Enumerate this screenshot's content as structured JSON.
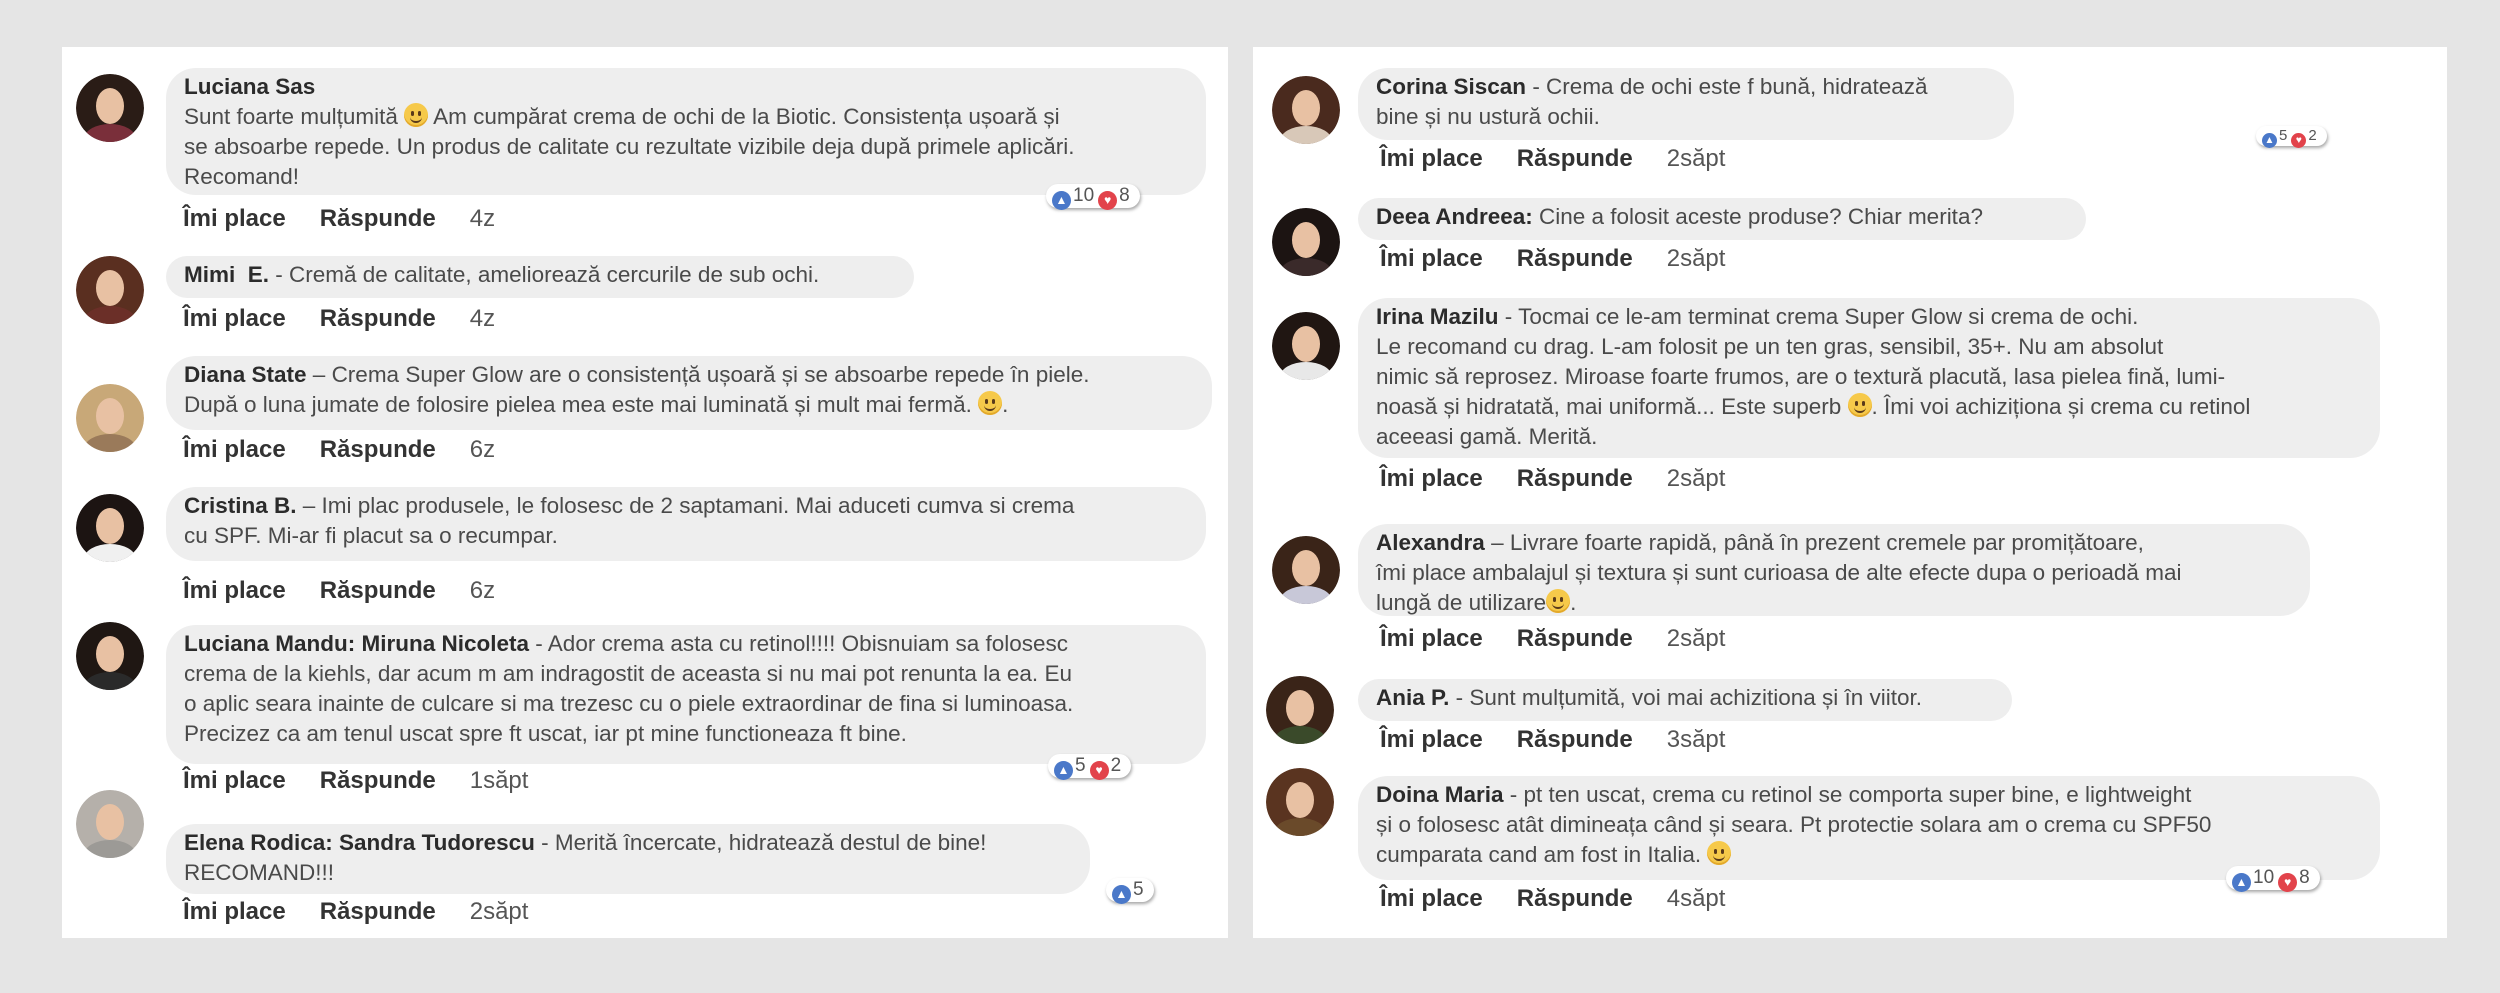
{
  "actions": {
    "like": "Îmi place",
    "reply": "Răspunde"
  },
  "colors": {
    "bubble": "#eeeeee",
    "like_icon": "#4a78c9",
    "love_icon": "#e2434b",
    "background": "#e5e5e5"
  },
  "icons": {
    "like": "thumbs-up-icon",
    "love": "heart-icon",
    "emoji": "smiley-emoji-icon"
  },
  "left": [
    {
      "name": "Luciana Sas",
      "text_html_lines": "Sunt foarte mulțumită 🙂 Am cumpărat crema de ochi de la Biotic. Consistența ușoară și\nse absoarbe repede. Un produs de calitate cu rezultate vizibile deja după primele aplicări.\nRecomand!",
      "time": "4z",
      "likes": "10",
      "loves": "8"
    },
    {
      "name": "Mimi  E.",
      "text_html_lines": " - Cremă de calitate, ameliorează cercurile de sub ochi.",
      "time": "4z"
    },
    {
      "name": "Diana State",
      "text_html_lines": " – Crema Super Glow are o consistență ușoară și se absoarbe repede în piele.\nDupă o luna jumate de folosire pielea mea este mai luminată și mult mai fermă. 🙂.",
      "time": "6z"
    },
    {
      "name": "Cristina B.",
      "text_html_lines": " – Imi plac produsele, le folosesc de 2 saptamani. Mai aduceti cumva si crema\ncu SPF. Mi-ar fi placut sa o recumpar.",
      "time": "6z"
    },
    {
      "name": "Luciana Mandu: Miruna Nicoleta",
      "text_html_lines": " - Ador crema asta cu retinol!!!! Obisnuiam sa folosesc\ncrema de la kiehls, dar acum m am indragostit de aceasta si nu mai pot renunta la ea. Eu\no aplic seara inainte de culcare si ma trezesc cu o piele extraordinar de fina si luminoasa.\nPrecizez ca am tenul uscat spre ft uscat, iar pt mine functioneaza ft bine.",
      "time": "1săpt",
      "likes": "5",
      "loves": "2"
    },
    {
      "name": "Elena Rodica: Sandra Tudorescu",
      "text_html_lines": " - Merită încercate, hidratează destul de bine!\nRECOMAND!!!",
      "time": "2săpt",
      "likes": "5"
    }
  ],
  "right": [
    {
      "name": "Corina Siscan",
      "text_html_lines": " - Crema de ochi este f bună, hidratează\nbine și nu ustură  ochii.",
      "time": "2săpt",
      "likes": "5",
      "loves": "2"
    },
    {
      "name": "Deea Andreea:",
      "text_html_lines": " Cine a folosit aceste produse? Chiar merita?",
      "time": "2săpt"
    },
    {
      "name": "Irina Mazilu",
      "text_html_lines": " - Tocmai ce le-am terminat crema Super Glow si crema de ochi.\nLe recomand cu drag. L-am folosit pe un ten gras, sensibil, 35+. Nu am absolut\nnimic să reprosez. Miroase foarte frumos, are o textură placută, lasa pielea fină, lumi-\nnoasă și hidratată, mai uniformă... Este superb 🙂. Îmi voi achiziționa și crema cu retinol\naceeasi gamă. Merită.",
      "time": "2săpt"
    },
    {
      "name": "Alexandra",
      "text_html_lines": " – Livrare foarte rapidă, până în prezent cremele par promițătoare,\nîmi place ambalajul și textura și sunt curioasa de alte efecte dupa o perioadă mai\nlungă de utilizare🙂.",
      "time": "2săpt"
    },
    {
      "name": "Ania P.",
      "text_html_lines": " - Sunt mulțumită, voi mai achizitiona și în viitor.",
      "time": "3săpt"
    },
    {
      "name": "Doina Maria",
      "text_html_lines": " - pt ten uscat, crema cu retinol se comporta super bine, e lightweight\nși o folosesc atât dimineața când și seara. Pt protectie solara am o crema cu SPF50\ncumparata cand am fost in Italia. 🙂",
      "time": "4săpt",
      "likes": "10",
      "loves": "8"
    }
  ]
}
